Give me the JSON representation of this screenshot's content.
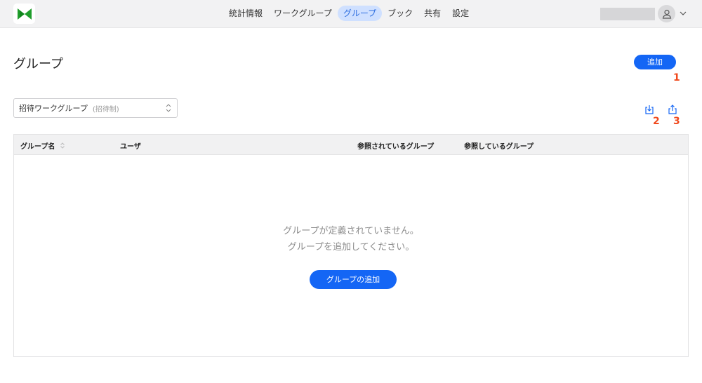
{
  "header": {
    "logo_icon": "bowtie-logo",
    "nav": [
      {
        "label": "統計情報",
        "active": false
      },
      {
        "label": "ワークグループ",
        "active": false
      },
      {
        "label": "グループ",
        "active": true
      },
      {
        "label": "ブック",
        "active": false
      },
      {
        "label": "共有",
        "active": false
      },
      {
        "label": "設定",
        "active": false
      }
    ],
    "avatar_icon": "user-icon",
    "chevron_icon": "chevron-down-icon"
  },
  "page": {
    "title": "グループ",
    "add_button": "追加"
  },
  "markers": {
    "m1": "1",
    "m2": "2",
    "m3": "3"
  },
  "workgroup_select": {
    "value": "招待ワークグループ",
    "subtext": "(招待制)"
  },
  "toolbar": {
    "import_icon": "import-icon",
    "export_icon": "export-icon"
  },
  "table": {
    "columns": [
      "グループ名",
      "ユーザ",
      "参照されているグループ",
      "参照しているグループ"
    ],
    "empty_line1": "グループが定義されていません。",
    "empty_line2": "グループを追加してください。",
    "add_group_button": "グループの追加"
  },
  "colors": {
    "accent": "#1466f5",
    "marker": "#f04a1e",
    "logo_green": "#1f9d2b"
  }
}
